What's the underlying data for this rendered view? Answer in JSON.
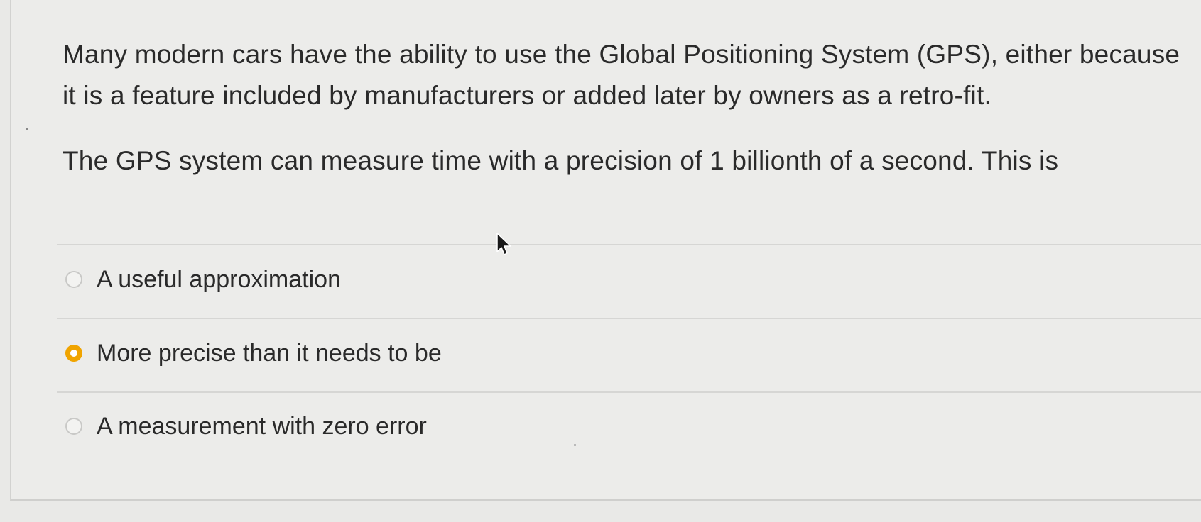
{
  "question": {
    "paragraph1": "Many modern cars have the ability to use the Global Positioning System (GPS), either because it is a feature included by manufacturers or added later by owners as a retro-fit.",
    "paragraph2": "The GPS system can measure time with a precision of 1 billionth of a second. This is"
  },
  "choices": [
    {
      "label": "A useful approximation",
      "selected": false
    },
    {
      "label": "More precise than it needs to be",
      "selected": true
    },
    {
      "label": "A measurement with zero error",
      "selected": false
    }
  ],
  "colors": {
    "selected_radio": "#f0a400",
    "background": "#ececea",
    "text": "#2a2a2a"
  },
  "icons": {
    "cursor": "mouse-pointer-icon"
  }
}
